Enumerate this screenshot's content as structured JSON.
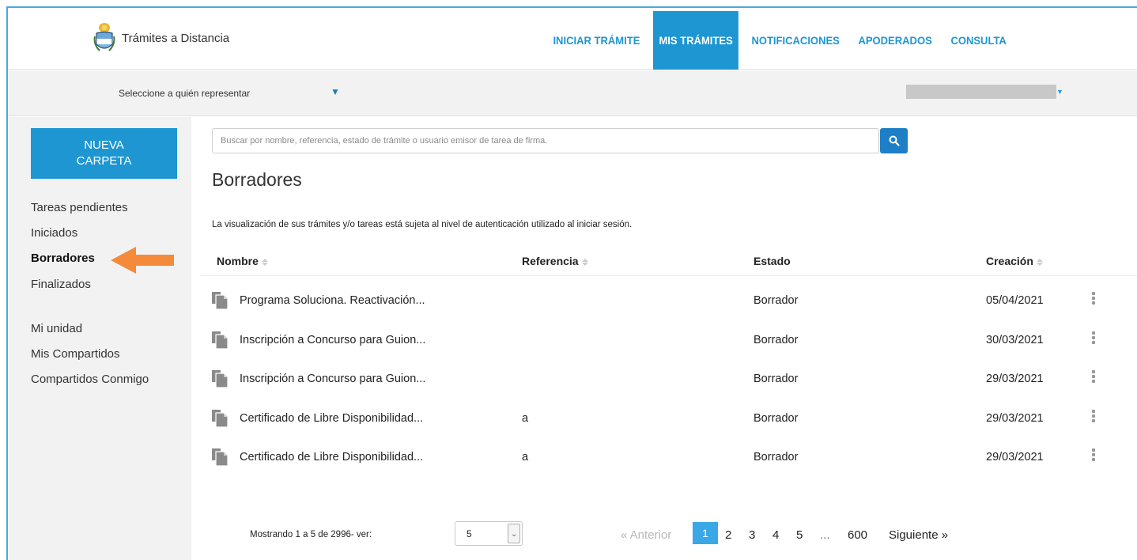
{
  "header": {
    "brand_title": "Trámites a Distancia",
    "nav": [
      {
        "label": "INICIAR TRÁMITE",
        "active": false
      },
      {
        "label": "MIS TRÁMITES",
        "active": true
      },
      {
        "label": "NOTIFICACIONES",
        "active": false
      },
      {
        "label": "APODERADOS",
        "active": false
      },
      {
        "label": "CONSULTA",
        "active": false
      }
    ]
  },
  "rep_bar": {
    "label": "Seleccione a quién representar",
    "arrow": "▼",
    "user_caret": "▼"
  },
  "sidebar": {
    "new_folder": "NUEVA\nCARPETA",
    "items": [
      {
        "label": "Tareas pendientes",
        "active": false
      },
      {
        "label": "Iniciados",
        "active": false
      },
      {
        "label": "Borradores",
        "active": true
      },
      {
        "label": "Finalizados",
        "active": false
      },
      {
        "label": "Mi unidad",
        "active": false
      },
      {
        "label": "Mis Compartidos",
        "active": false
      },
      {
        "label": "Compartidos Conmigo",
        "active": false
      }
    ]
  },
  "search": {
    "placeholder": "Buscar por nombre, referencia, estado de trámite o usuario emisor de tarea de firma."
  },
  "main": {
    "title": "Borradores",
    "notice": "La visualización de sus trámites y/o tareas está sujeta al nivel de autenticación utilizado al iniciar sesión.",
    "columns": {
      "name": "Nombre",
      "reference": "Referencia",
      "state": "Estado",
      "created": "Creación"
    },
    "rows": [
      {
        "name": "Programa Soluciona. Reactivación...",
        "reference": "",
        "state": "Borrador",
        "created": "05/04/2021"
      },
      {
        "name": "Inscripción a Concurso para Guion...",
        "reference": "",
        "state": "Borrador",
        "created": "30/03/2021"
      },
      {
        "name": "Inscripción a Concurso para Guion...",
        "reference": "",
        "state": "Borrador",
        "created": "29/03/2021"
      },
      {
        "name": "Certificado de Libre Disponibilidad...",
        "reference": "a",
        "state": "Borrador",
        "created": "29/03/2021"
      },
      {
        "name": "Certificado de Libre Disponibilidad...",
        "reference": "a",
        "state": "Borrador",
        "created": "29/03/2021"
      }
    ]
  },
  "footer": {
    "showing": "Mostrando 1 a 5 de 2996- ver:",
    "page_size": "5",
    "pagination": {
      "prev": "« Anterior",
      "pages": [
        "1",
        "2",
        "3",
        "4",
        "5"
      ],
      "ellipsis": "...",
      "last": "600",
      "next": "Siguiente »"
    }
  },
  "colors": {
    "accent": "#1d96d2",
    "search_button": "#1d7fc6",
    "current_page": "#3aa8e6",
    "arrow_annotation": "#f58a3a",
    "panel_gray": "#f2f2f2"
  }
}
